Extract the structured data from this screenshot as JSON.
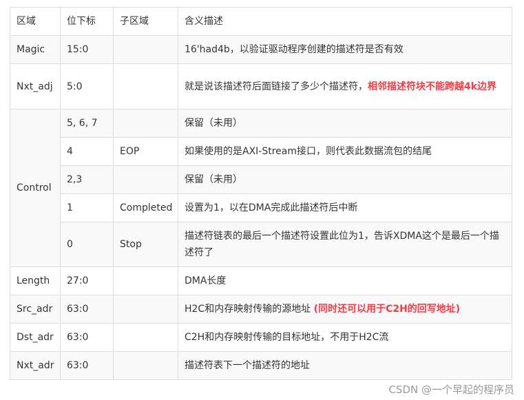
{
  "headers": [
    "区域",
    "位下标",
    "子区域",
    "含义描述"
  ],
  "rows": {
    "magic": {
      "field": "Magic",
      "bits": "15:0",
      "sub": "",
      "desc": "16'had4b，以验证驱动程序创建的描述符是否有效"
    },
    "nxt_adj": {
      "field": "Nxt_adj",
      "bits": "5:0",
      "sub": "",
      "desc_plain": "就是说该描述符后面链接了多少个描述符，",
      "desc_red": "相邻描述符块不能跨越4k边界"
    },
    "control": {
      "field": "Control",
      "sub_rows": [
        {
          "bits": "5, 6, 7",
          "sub": "",
          "desc": "保留（未用）"
        },
        {
          "bits": "4",
          "sub": "EOP",
          "desc": "如果使用的是AXI-Stream接口，则代表此数据流包的结尾"
        },
        {
          "bits": "2,3",
          "sub": "",
          "desc": "保留（未用）"
        },
        {
          "bits": "1",
          "sub": "Completed",
          "desc": "设置为1，以在DMA完成此描述符后中断"
        },
        {
          "bits": "0",
          "sub": "Stop",
          "desc": "描述符链表的最后一个描述符设置此位为1，告诉XDMA这个是最后一个描述符了"
        }
      ]
    },
    "length": {
      "field": "Length",
      "bits": "27:0",
      "sub": "",
      "desc": "DMA长度"
    },
    "src_adr": {
      "field": "Src_adr",
      "bits": "63:0",
      "sub": "",
      "desc_plain": "H2C和内存映射传输的源地址 ",
      "desc_red": "(同时还可以用于C2H的回写地址)"
    },
    "dst_adr": {
      "field": "Dst_adr",
      "bits": "63:0",
      "sub": "",
      "desc": "C2H和内存映射传输的目标地址，不用于H2C流"
    },
    "nxt_adr": {
      "field": "Nxt_adr",
      "bits": "63:0",
      "sub": "",
      "desc": "描述符表下一个描述符的地址"
    }
  },
  "watermark": "CSDN @一个早起的程序员",
  "colors": {
    "highlight_red": "#f33b45",
    "border": "#dddddd",
    "stripe": "#f9f9f9"
  }
}
